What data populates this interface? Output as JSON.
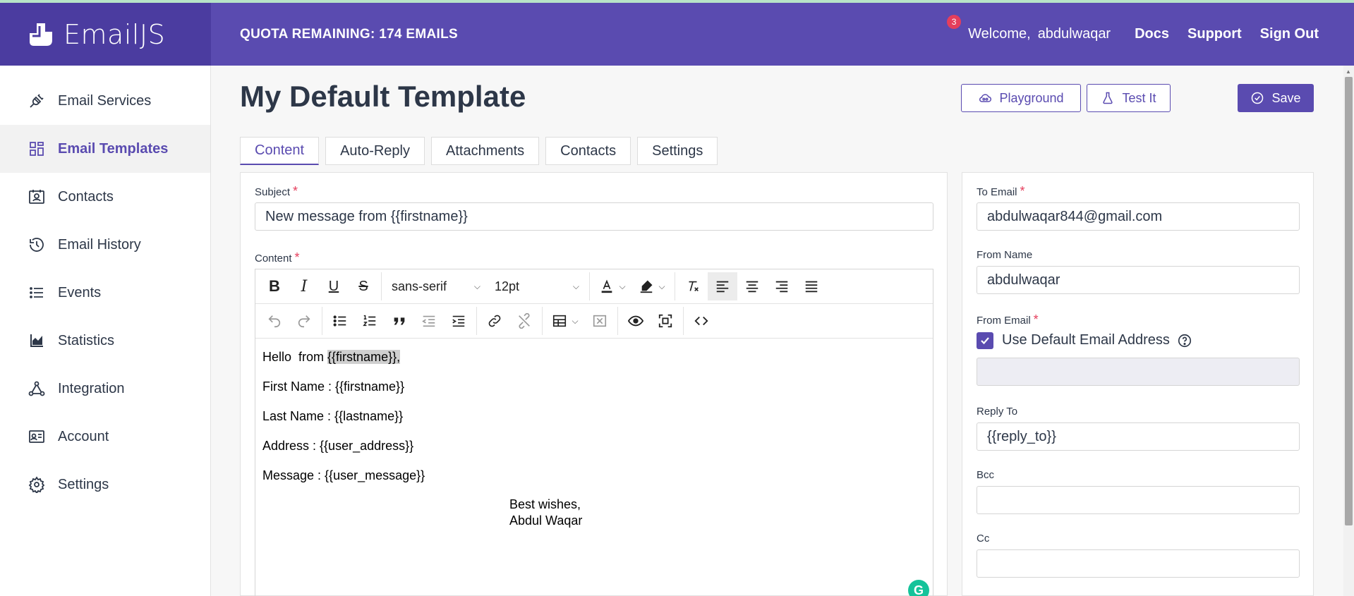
{
  "brand": {
    "name": "EmailJS"
  },
  "header": {
    "quota": "QUOTA REMAINING: 174 EMAILS",
    "notification_count": "3",
    "welcome": "Welcome,",
    "username": "abdulwaqar",
    "links": [
      "Docs",
      "Support",
      "Sign Out"
    ]
  },
  "sidebar": {
    "items": [
      {
        "label": "Email Services",
        "icon": "plug-icon"
      },
      {
        "label": "Email Templates",
        "icon": "templates-icon",
        "active": true
      },
      {
        "label": "Contacts",
        "icon": "contacts-icon"
      },
      {
        "label": "Email History",
        "icon": "history-icon"
      },
      {
        "label": "Events",
        "icon": "list-icon"
      },
      {
        "label": "Statistics",
        "icon": "chart-icon"
      },
      {
        "label": "Integration",
        "icon": "integration-icon"
      },
      {
        "label": "Account",
        "icon": "account-icon"
      },
      {
        "label": "Settings",
        "icon": "gear-icon"
      }
    ]
  },
  "page": {
    "title": "My Default Template",
    "buttons": {
      "playground": "Playground",
      "test": "Test It",
      "save": "Save"
    },
    "tabs": [
      "Content",
      "Auto-Reply",
      "Attachments",
      "Contacts",
      "Settings"
    ]
  },
  "form": {
    "subject_label": "Subject",
    "subject_value": "New message from {{firstname}}",
    "content_label": "Content",
    "font_family": "sans-serif",
    "font_size": "12pt",
    "body": {
      "line1_prefix": "Hello  from ",
      "line1_highlight": "{{firstname}},",
      "line2": "First Name : {{firstname}}",
      "line3": "Last Name : {{lastname}}",
      "line4": "Address : {{user_address}}",
      "line5": "Message : {{user_message}}",
      "sign1": "Best wishes,",
      "sign2": "Abdul Waqar"
    }
  },
  "right": {
    "to_email_label": "To Email",
    "to_email_value": "abdulwaqar844@gmail.com",
    "from_name_label": "From Name",
    "from_name_value": "abdulwaqar",
    "from_email_label": "From Email",
    "use_default_label": "Use Default Email Address",
    "use_default_checked": true,
    "reply_to_label": "Reply To",
    "reply_to_value": "{{reply_to}}",
    "bcc_label": "Bcc",
    "cc_label": "Cc"
  },
  "colors": {
    "brand": "#5a4bb0",
    "brand_dark": "#4b3ca0",
    "required": "#e53e5c"
  }
}
